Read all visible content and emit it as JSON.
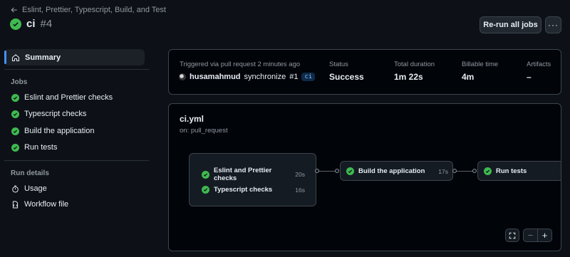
{
  "header": {
    "back_label": "Eslint, Prettier, Typescript, Build, and Test",
    "run_name": "ci",
    "run_number": "#4",
    "rerun_label": "Re-run all jobs",
    "more_label": "···"
  },
  "sidebar": {
    "summary_label": "Summary",
    "jobs_heading": "Jobs",
    "jobs": [
      {
        "label": "Eslint and Prettier checks",
        "status": "success"
      },
      {
        "label": "Typescript checks",
        "status": "success"
      },
      {
        "label": "Build the application",
        "status": "success"
      },
      {
        "label": "Run tests",
        "status": "success"
      }
    ],
    "run_details_heading": "Run details",
    "usage_label": "Usage",
    "workflow_file_label": "Workflow file"
  },
  "summary": {
    "trigger_text": "Triggered via pull request 2 minutes ago",
    "actor": "husamahmud",
    "event": "synchronize",
    "pr": "#1",
    "branch": "ci",
    "status_label": "Status",
    "status_value": "Success",
    "duration_label": "Total duration",
    "duration_value": "1m 22s",
    "billable_label": "Billable time",
    "billable_value": "4m",
    "artifacts_label": "Artifacts",
    "artifacts_value": "–"
  },
  "workflow": {
    "file": "ci.yml",
    "trigger": "on: pull_request",
    "group1": [
      {
        "name": "Eslint and Prettier checks",
        "duration": "20s"
      },
      {
        "name": "Typescript checks",
        "duration": "16s"
      }
    ],
    "build": {
      "name": "Build the application",
      "duration": "17s"
    },
    "tests": {
      "name": "Run tests",
      "duration": ""
    },
    "zoom_out_label": "−",
    "zoom_in_label": "+"
  },
  "colors": {
    "success": "#3fb950",
    "accent": "#4493f8",
    "background": "#0d1117"
  },
  "icons": [
    "arrow-left-icon",
    "check-circle-icon",
    "home-icon",
    "stopwatch-icon",
    "file-icon",
    "fullscreen-icon"
  ]
}
